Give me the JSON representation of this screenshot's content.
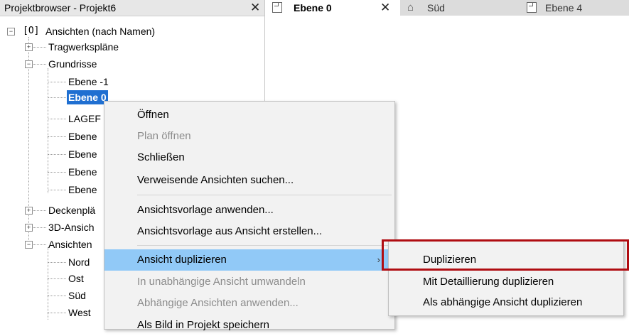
{
  "project_browser": {
    "title": "Projektbrowser - Projekt6",
    "close_glyph": "✕",
    "tree": {
      "root_label": "Ansichten (nach Namen)",
      "tragwerksplaene": "Tragwerkspläne",
      "grundrisse": "Grundrisse",
      "grundrisse_items": [
        "Ebene -1",
        "Ebene 0",
        "LAGEF",
        "Ebene",
        "Ebene",
        "Ebene",
        "Ebene"
      ],
      "deckenplaene": "Deckenplä",
      "ansichten_3d": "3D-Ansich",
      "ansichten": "Ansichten",
      "ansichten_items": [
        "Nord",
        "Ost",
        "Süd",
        "West"
      ]
    }
  },
  "tabs": [
    {
      "label": "Ebene 0",
      "active": true,
      "icon": "floor-plan-icon"
    },
    {
      "label": "Süd",
      "active": false,
      "icon": "elevation-icon"
    },
    {
      "label": "Ebene 4",
      "active": false,
      "icon": "floor-plan-icon"
    }
  ],
  "tab_close_glyph": "✕",
  "context_menu": {
    "items": [
      {
        "label": "Öffnen",
        "disabled": false
      },
      {
        "label": "Plan öffnen",
        "disabled": true
      },
      {
        "label": "Schließen",
        "disabled": false
      },
      {
        "label": "Verweisende Ansichten suchen...",
        "disabled": false
      },
      {
        "label": "Ansichtsvorlage anwenden...",
        "disabled": false
      },
      {
        "label": "Ansichtsvorlage aus Ansicht erstellen...",
        "disabled": false
      },
      {
        "label": "Ansicht duplizieren",
        "disabled": false,
        "has_submenu": true
      },
      {
        "label": "In unabhängige Ansicht umwandeln",
        "disabled": true
      },
      {
        "label": "Abhängige Ansichten anwenden...",
        "disabled": true
      },
      {
        "label": "Als Bild in Projekt speichern",
        "disabled": false
      }
    ],
    "submenu_arrow": "›"
  },
  "submenu": {
    "items": [
      {
        "label": "Duplizieren"
      },
      {
        "label": "Mit Detaillierung duplizieren"
      },
      {
        "label": "Als abhängige Ansicht duplizieren"
      }
    ]
  },
  "colors": {
    "selection": "#1f6fd1",
    "menu_hover": "#91c9f7",
    "highlight_box": "#b00d12"
  }
}
